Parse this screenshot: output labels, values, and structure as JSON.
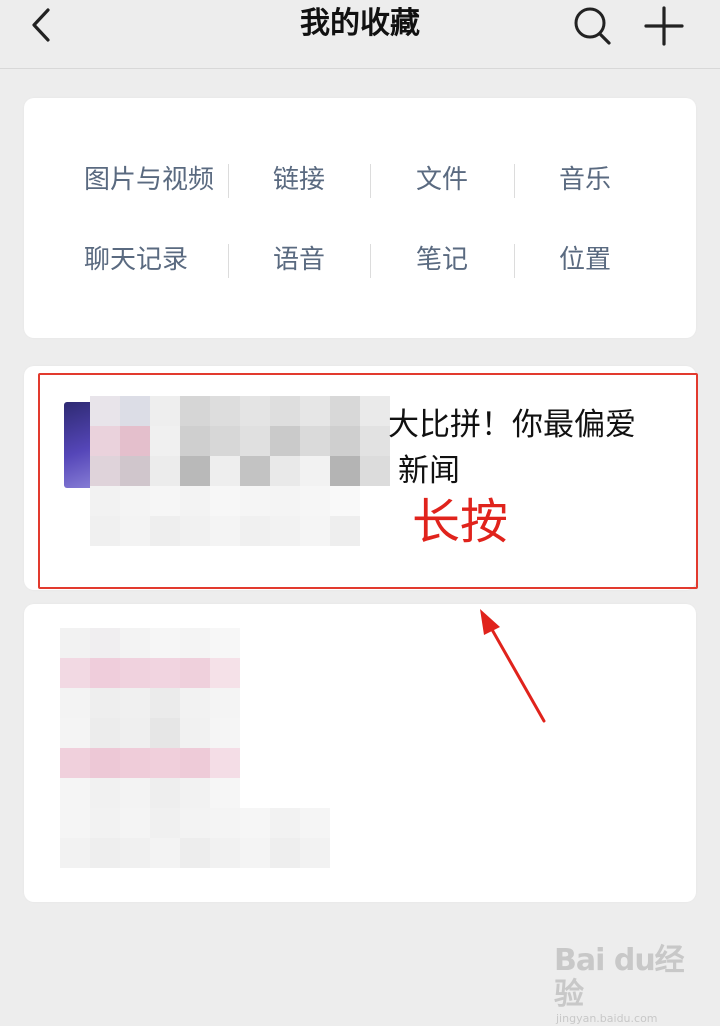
{
  "header": {
    "title": "我的收藏",
    "back_icon": "chevron-left-icon",
    "search_icon": "search-icon",
    "add_icon": "plus-icon"
  },
  "categories": [
    {
      "label": "图片与视频"
    },
    {
      "label": "链接"
    },
    {
      "label": "文件"
    },
    {
      "label": "音乐"
    },
    {
      "label": "聊天记录"
    },
    {
      "label": "语音"
    },
    {
      "label": "笔记"
    },
    {
      "label": "位置"
    }
  ],
  "favorites": [
    {
      "title": "大比拼！你最偏爱",
      "subtitle": "新闻",
      "blurred": true
    },
    {
      "blurred": true
    }
  ],
  "annotation": {
    "label": "长按",
    "color": "#e0231c"
  },
  "watermark": {
    "logo": "Bai du经验",
    "url": "jingyan.baidu.com"
  }
}
